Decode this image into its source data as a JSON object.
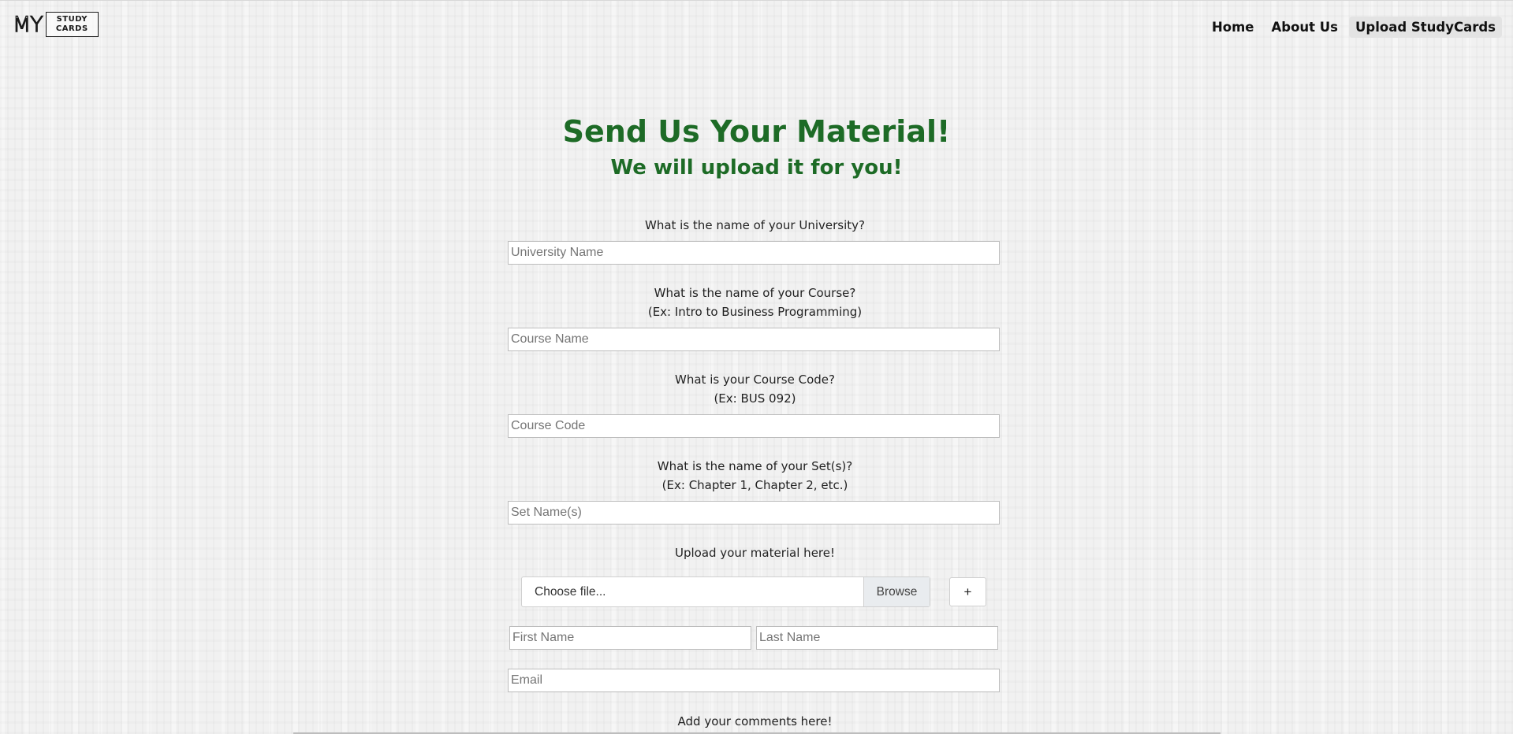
{
  "header": {
    "logo": {
      "my": "MY",
      "line1": "STUDY",
      "line2": "CARDS"
    },
    "nav": [
      {
        "label": "Home"
      },
      {
        "label": "About Us"
      },
      {
        "label": "Upload StudyCards"
      }
    ]
  },
  "page": {
    "title": "Send Us Your Material!",
    "subtitle": "We will upload it for you!"
  },
  "form": {
    "university": {
      "question": "What is the name of your University?",
      "placeholder": "University Name",
      "value": ""
    },
    "course": {
      "question": "What is the name of your Course?",
      "example": "(Ex: Intro to Business Programming)",
      "placeholder": "Course Name",
      "value": ""
    },
    "course_code": {
      "question": "What is your Course Code?",
      "example": "(Ex: BUS 092)",
      "placeholder": "Course Code",
      "value": ""
    },
    "sets": {
      "question": "What is the name of your Set(s)?",
      "example": "(Ex: Chapter 1, Chapter 2, etc.)",
      "placeholder": "Set Name(s)",
      "value": ""
    },
    "upload": {
      "label": "Upload your material here!",
      "file_text": "Choose file...",
      "browse_label": "Browse",
      "add_label": "+"
    },
    "first_name": {
      "placeholder": "First Name",
      "value": ""
    },
    "last_name": {
      "placeholder": "Last Name",
      "value": ""
    },
    "email": {
      "placeholder": "Email",
      "value": ""
    },
    "comments": {
      "label": "Add your comments here!"
    }
  },
  "colors": {
    "heading_green": "#1d6b26",
    "active_nav_bg": "#e3e3e3"
  }
}
